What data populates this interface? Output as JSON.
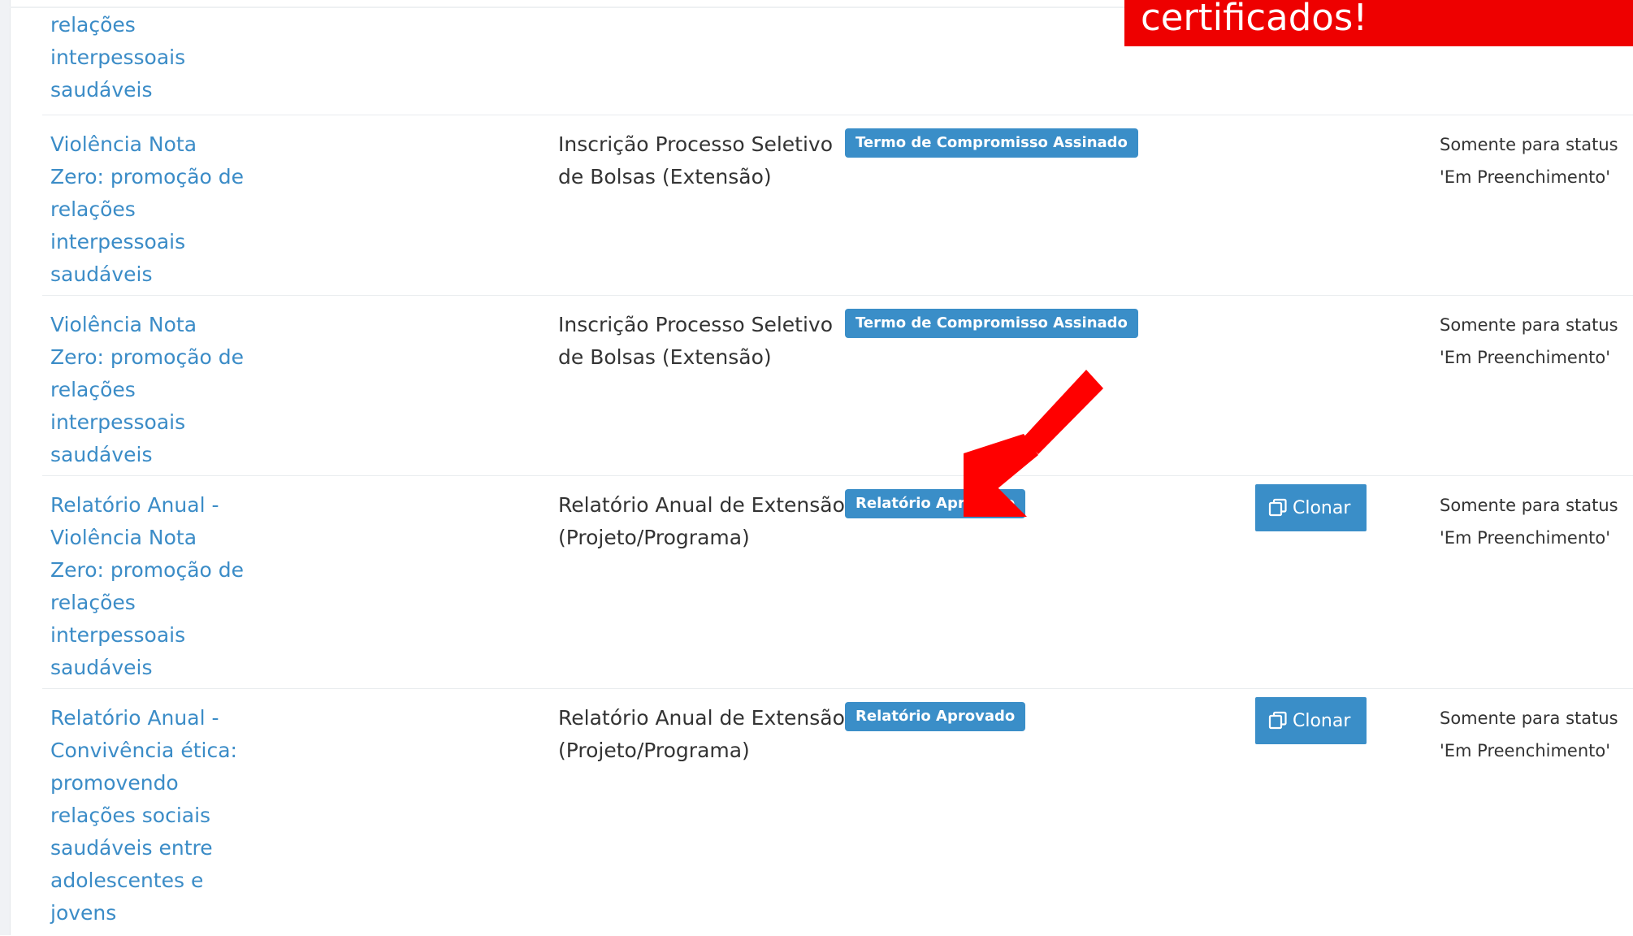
{
  "banner": {
    "text": "certificados!"
  },
  "colors": {
    "link": "#3b8cc7",
    "badge": "#3a8ec8",
    "banner": "#ee0000",
    "arrow": "#ff0000"
  },
  "rows": [
    {
      "title_lines": [
        "relações",
        "interpessoais",
        "saudáveis"
      ]
    },
    {
      "title_lines": [
        "Violência Nota",
        "Zero: promoção de",
        "relações",
        "interpessoais",
        "saudáveis"
      ],
      "type_lines": [
        "Inscrição Processo Seletivo",
        "de Bolsas (Extensão)"
      ],
      "status": "Termo de Compromisso Assinado",
      "note_lines": [
        "Somente para status",
        "'Em Preenchimento'"
      ]
    },
    {
      "title_lines": [
        "Violência Nota",
        "Zero: promoção de",
        "relações",
        "interpessoais",
        "saudáveis"
      ],
      "type_lines": [
        "Inscrição Processo Seletivo",
        "de Bolsas (Extensão)"
      ],
      "status": "Termo de Compromisso Assinado",
      "note_lines": [
        "Somente para status",
        "'Em Preenchimento'"
      ]
    },
    {
      "title_lines": [
        "Relatório Anual -",
        "Violência Nota",
        "Zero: promoção de",
        "relações",
        "interpessoais",
        "saudáveis"
      ],
      "type_lines": [
        "Relatório Anual de Extensão",
        "(Projeto/Programa)"
      ],
      "status": "Relatório Aprovado",
      "action": "Clonar",
      "note_lines": [
        "Somente para status",
        "'Em Preenchimento'"
      ]
    },
    {
      "title_lines": [
        "Relatório Anual -",
        "Convivência ética:",
        "promovendo",
        "relações sociais",
        "saudáveis entre",
        "adolescentes e",
        "jovens"
      ],
      "type_lines": [
        "Relatório Anual de Extensão",
        "(Projeto/Programa)"
      ],
      "status": "Relatório Aprovado",
      "action": "Clonar",
      "note_lines": [
        "Somente para status",
        "'Em Preenchimento'"
      ]
    }
  ],
  "icons": {
    "clone": "copy-icon",
    "annotation": "red-arrow-icon"
  }
}
